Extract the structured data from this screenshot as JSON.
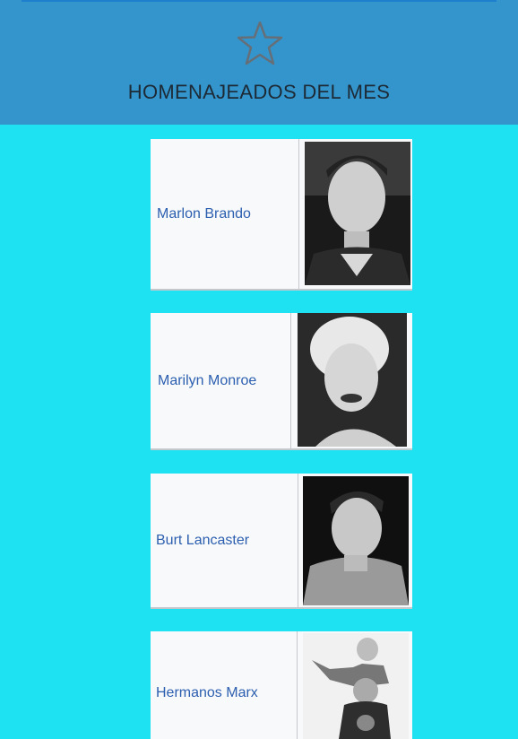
{
  "header": {
    "icon": "star-icon",
    "title": "HOMENAJEADOS DEL MES",
    "background": "#3395cc"
  },
  "page_background": "#1ee1f2",
  "honorees": [
    {
      "name": "Marlon Brando",
      "photo": "portrait-photo"
    },
    {
      "name": "Marilyn Monroe",
      "photo": "portrait-photo"
    },
    {
      "name": "Burt Lancaster",
      "photo": "portrait-photo"
    },
    {
      "name": "Hermanos Marx",
      "photo": "group-photo"
    }
  ]
}
